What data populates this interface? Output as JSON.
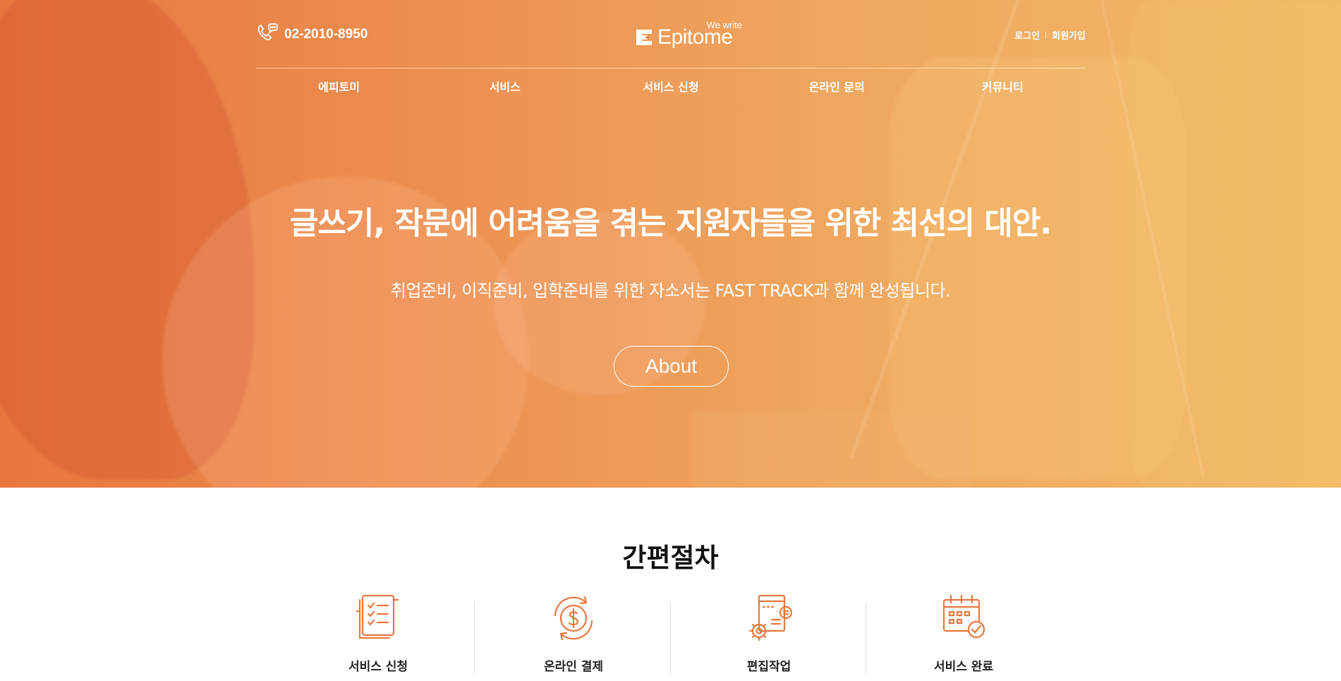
{
  "header": {
    "phone": "02-2010-8950",
    "logo_tagline": "We write",
    "logo_name": "Epitome",
    "login": "로그인",
    "signup": "회원가입"
  },
  "nav": {
    "items": [
      {
        "label": "에피토미"
      },
      {
        "label": "서비스"
      },
      {
        "label": "서비스 신청"
      },
      {
        "label": "온라인 문의"
      },
      {
        "label": "커뮤니티"
      }
    ]
  },
  "hero": {
    "title": "글쓰기, 작문에 어려움을 겪는 지원자들을 위한 최선의 대안.",
    "subtitle": "취업준비, 이직준비, 입학준비를 위한 자소서는 FAST TRACK과 함께 완성됩니다.",
    "button": "About"
  },
  "process": {
    "title": "간편절차",
    "steps": [
      {
        "label": "서비스 신청",
        "icon": "checklist-icon"
      },
      {
        "label": "온라인 결제",
        "icon": "dollar-cycle-icon"
      },
      {
        "label": "편집작업",
        "icon": "document-gear-icon"
      },
      {
        "label": "서비스 완료",
        "icon": "calendar-check-icon"
      }
    ]
  },
  "colors": {
    "accent": "#e8773f",
    "hero_end": "#f2b967",
    "icon": "#e8773f"
  }
}
